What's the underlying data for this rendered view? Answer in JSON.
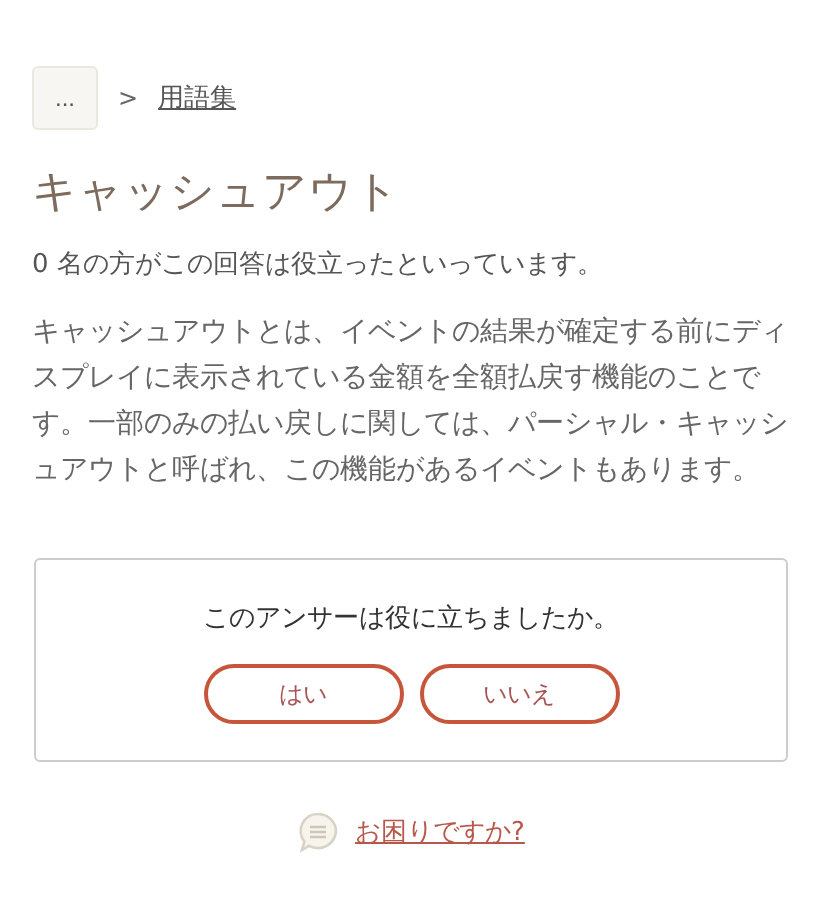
{
  "breadcrumb": {
    "more": "...",
    "separator": ">",
    "link": "用語集"
  },
  "title": "キャッシュアウト",
  "helpful_count": "0 名の方がこの回答は役立ったといっています。",
  "body": "キャッシュアウトとは、イベントの結果が確定する前にディスプレイに表示されている金額を全額払戻す機能のことです。一部のみの払い戻しに関しては、パーシャル・キャッシュアウトと呼ばれ、この機能があるイベントもあります。",
  "feedback": {
    "question": "このアンサーは役に立ちましたか。",
    "buttons": [
      "はい",
      "いいえ"
    ]
  },
  "help_link": "お困りですか?"
}
